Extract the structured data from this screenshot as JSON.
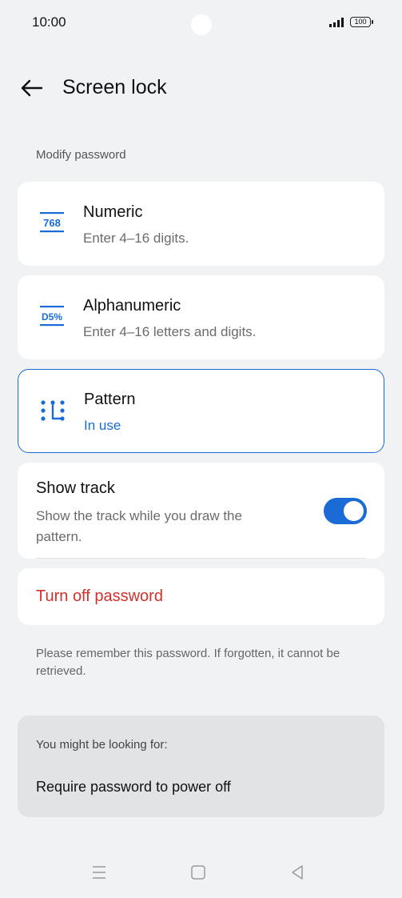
{
  "status": {
    "time": "10:00",
    "battery": "100"
  },
  "header": {
    "title": "Screen lock"
  },
  "section_label": "Modify password",
  "options": [
    {
      "title": "Numeric",
      "subtitle": "Enter 4–16 digits.",
      "icon": "768"
    },
    {
      "title": "Alphanumeric",
      "subtitle": "Enter 4–16 letters and digits.",
      "icon": "D5%"
    },
    {
      "title": "Pattern",
      "subtitle": "In use"
    }
  ],
  "show_track": {
    "title": "Show track",
    "description": "Show the track while you draw the pattern.",
    "enabled": true
  },
  "turn_off_label": "Turn off password",
  "note": "Please remember this password. If forgotten, it cannot be retrieved.",
  "suggestions": {
    "label": "You might be looking for:",
    "item": "Require password to power off"
  },
  "colors": {
    "accent": "#1a6bd6",
    "danger": "#d0312d",
    "background": "#f1f2f4"
  },
  "icons": [
    "back-arrow-icon",
    "numeric-icon",
    "alphanumeric-icon",
    "pattern-icon",
    "signal-icon",
    "battery-icon",
    "menu-icon",
    "home-icon",
    "back-icon"
  ]
}
